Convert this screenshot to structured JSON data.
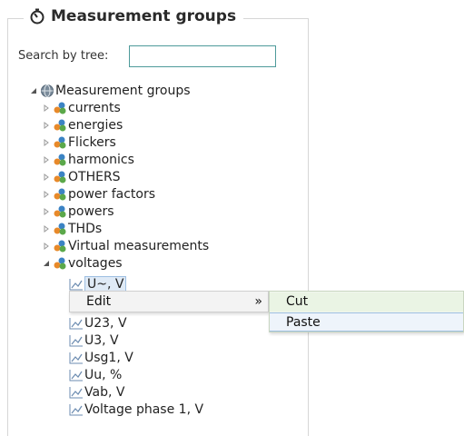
{
  "panel": {
    "title": "Measurement groups",
    "title_icon": "timer-icon"
  },
  "search": {
    "label": "Search by tree:",
    "value": "",
    "placeholder": ""
  },
  "tree": {
    "root": {
      "label": "Measurement groups",
      "icon": "globe-icon",
      "expanded": true
    },
    "groups": [
      {
        "label": "currents",
        "expanded": false
      },
      {
        "label": "energies",
        "expanded": false
      },
      {
        "label": "Flickers",
        "expanded": false
      },
      {
        "label": "harmonics",
        "expanded": false
      },
      {
        "label": "OTHERS",
        "expanded": false
      },
      {
        "label": "power factors",
        "expanded": false
      },
      {
        "label": "powers",
        "expanded": false
      },
      {
        "label": "THDs",
        "expanded": false
      },
      {
        "label": "Virtual measurements",
        "expanded": false
      },
      {
        "label": "voltages",
        "expanded": true
      }
    ],
    "voltage_items": [
      {
        "label": "U~, V",
        "selected": true
      },
      {
        "label": "U23, V"
      },
      {
        "label": "U3, V"
      },
      {
        "label": "Usg1, V"
      },
      {
        "label": "Uu, %"
      },
      {
        "label": "Vab, V"
      },
      {
        "label": "Voltage phase 1, V"
      }
    ]
  },
  "context_menu": {
    "edit_label": "Edit",
    "submenu_arrow": "»",
    "submenu": {
      "cut_label": "Cut",
      "paste_label": "Paste"
    }
  },
  "colors": {
    "group_icon_orange": "#e8892a",
    "group_icon_blue": "#3b83c4",
    "group_icon_green": "#5ba84a",
    "selection": "#dfeaf6"
  }
}
